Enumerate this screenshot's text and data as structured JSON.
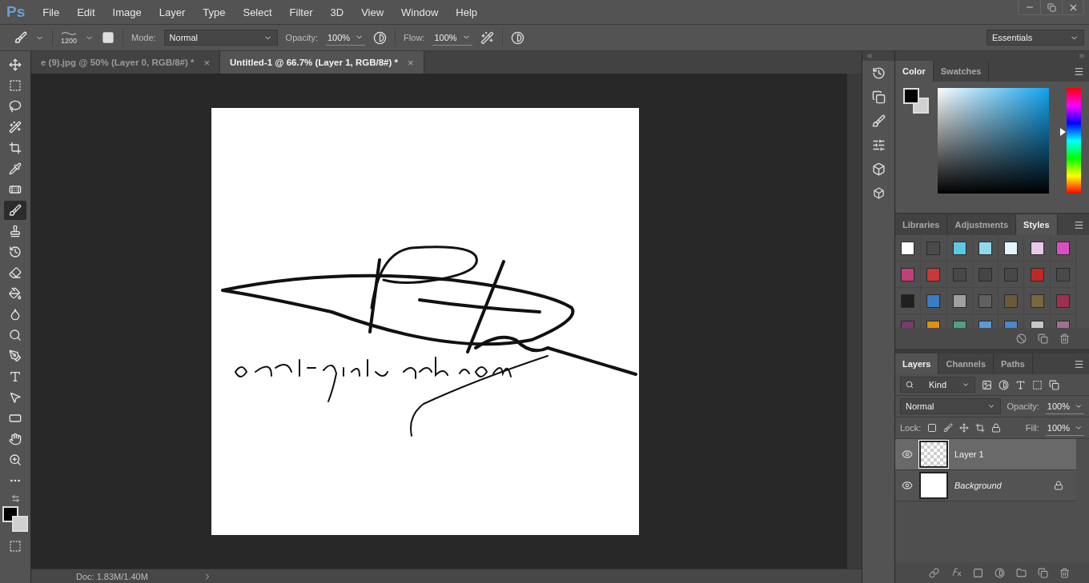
{
  "app": {
    "logo": "Ps"
  },
  "menu": [
    "File",
    "Edit",
    "Image",
    "Layer",
    "Type",
    "Select",
    "Filter",
    "3D",
    "View",
    "Window",
    "Help"
  ],
  "options_bar": {
    "brush_size": "1200",
    "mode_label": "Mode:",
    "mode": "Normal",
    "opacity_label": "Opacity:",
    "opacity": "100%",
    "flow_label": "Flow:",
    "flow": "100%",
    "workspace": "Essentials"
  },
  "doc_tabs": [
    {
      "title": "e (9).jpg @ 50% (Layer 0, RGB/8#) *",
      "close": "×",
      "selected": false
    },
    {
      "title": "Untitled-1 @ 66.7% (Layer 1, RGB/8#) *",
      "close": "×",
      "selected": true
    }
  ],
  "tools": [
    {
      "kind": "move",
      "selected": false
    },
    {
      "kind": "marquee",
      "selected": false
    },
    {
      "kind": "lasso",
      "selected": false
    },
    {
      "kind": "quick-select",
      "selected": false
    },
    {
      "kind": "crop",
      "selected": false
    },
    {
      "kind": "eyedropper",
      "selected": false
    },
    {
      "kind": "healing",
      "selected": false
    },
    {
      "kind": "brush",
      "selected": true
    },
    {
      "kind": "stamp",
      "selected": false
    },
    {
      "kind": "history-brush",
      "selected": false
    },
    {
      "kind": "eraser",
      "selected": false
    },
    {
      "kind": "bucket",
      "selected": false
    },
    {
      "kind": "blur",
      "selected": false
    },
    {
      "kind": "dodge",
      "selected": false
    },
    {
      "kind": "pen",
      "selected": false
    },
    {
      "kind": "type",
      "selected": false
    },
    {
      "kind": "select",
      "selected": false
    },
    {
      "kind": "shape",
      "selected": false
    },
    {
      "kind": "hand",
      "selected": false
    },
    {
      "kind": "zoom",
      "selected": false
    },
    {
      "kind": "more",
      "selected": false
    }
  ],
  "status_bar": {
    "doc": "Doc: 1.83M/1.40M"
  },
  "color_panel": {
    "tabs": [
      {
        "label": "Color",
        "selected": true
      },
      {
        "label": "Swatches",
        "selected": false
      }
    ],
    "hue": {
      "level": 0.58
    }
  },
  "styles_panel": {
    "tabs": [
      {
        "label": "Libraries",
        "selected": false
      },
      {
        "label": "Adjustments",
        "selected": false
      },
      {
        "label": "Styles",
        "selected": true
      }
    ],
    "styles": [
      {
        "color": "#ffffff"
      },
      {
        "color": "#4a4a4a"
      },
      {
        "color": "#5cc8e6"
      },
      {
        "color": "#8fd8ee"
      },
      {
        "color": "#e4f4fb"
      },
      {
        "color": "#e8c8e8"
      },
      {
        "color": "#d850c0"
      },
      {
        "color": "#c0407a"
      },
      {
        "color": "#c83838"
      },
      {
        "color": "#484848"
      },
      {
        "color": "#454545"
      },
      {
        "color": "#484848"
      },
      {
        "color": "#c02828"
      },
      {
        "color": "#4a4a48"
      },
      {
        "color": "#202020"
      },
      {
        "color": "#3a7cc8"
      },
      {
        "color": "#a0a0a0"
      },
      {
        "color": "#606060"
      },
      {
        "color": "#6a5a3a"
      },
      {
        "color": "#7a6640"
      },
      {
        "color": "#a03050"
      },
      {
        "color": "#7a3a6a"
      },
      {
        "color": "#e09010"
      },
      {
        "color": "#50a080"
      },
      {
        "color": "#5a9ad8"
      },
      {
        "color": "#4a88c8"
      },
      {
        "color": "#c8c8c8"
      },
      {
        "color": "#a07090"
      }
    ]
  },
  "layers_panel": {
    "tabs": [
      {
        "label": "Layers",
        "selected": true
      },
      {
        "label": "Channels",
        "selected": false
      },
      {
        "label": "Paths",
        "selected": false
      }
    ],
    "filter": "Kind",
    "blend_mode": "Normal",
    "opacity_label": "Opacity:",
    "opacity": "100%",
    "lock_label": "Lock:",
    "fill_label": "Fill:",
    "fill": "100%",
    "layers": [
      {
        "name": "Layer 1",
        "kind": "transparent",
        "selected": true,
        "visible": true,
        "locked": false
      },
      {
        "name": "Background",
        "kind": "background",
        "selected": false,
        "visible": true,
        "locked": true
      }
    ]
  }
}
